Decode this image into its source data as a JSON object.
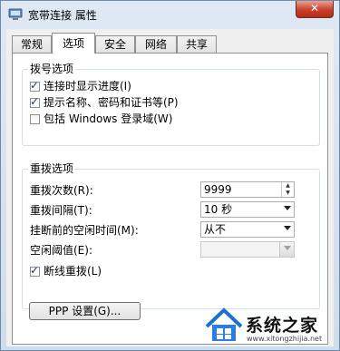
{
  "window": {
    "title": "宽带连接 属性",
    "close_label": "✕"
  },
  "tabs": [
    {
      "label": "常规"
    },
    {
      "label": "选项"
    },
    {
      "label": "安全"
    },
    {
      "label": "网络"
    },
    {
      "label": "共享"
    }
  ],
  "active_tab": "选项",
  "dial_options": {
    "title": "拨号选项",
    "items": [
      {
        "label": "连接时显示进度(I)",
        "checked": true
      },
      {
        "label": "提示名称、密码和证书等(P)",
        "checked": true
      },
      {
        "label": "包括 Windows 登录域(W)",
        "checked": false
      }
    ]
  },
  "redial_options": {
    "title": "重拨选项",
    "redial_attempts": {
      "label": "重拨次数(R):",
      "value": "9999"
    },
    "redial_interval": {
      "label": "重拨间隔(T):",
      "value": "10 秒"
    },
    "idle_hangup": {
      "label": "挂断前的空闲时间(M):",
      "value": "从不"
    },
    "idle_threshold": {
      "label": "空闲阈值(E):",
      "value": ""
    },
    "redial_on_drop": {
      "label": "断线重拨(L)",
      "checked": true
    }
  },
  "ppp_button": {
    "label": "PPP 设置(G)..."
  },
  "watermark": {
    "text": "系统之家",
    "sub": "www.xitongzhijia.net"
  }
}
